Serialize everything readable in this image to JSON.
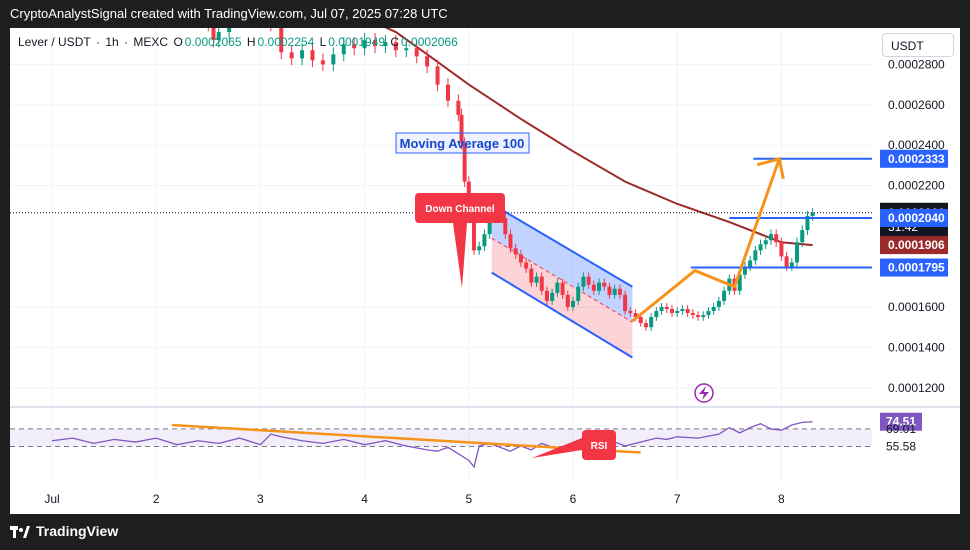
{
  "header": {
    "title": "CryptoAnalystSignal created with TradingView.com, Jul 07, 2025 07:28 UTC"
  },
  "symbol": {
    "pair": "Lever / USDT",
    "interval": "1h",
    "exchange": "MEXC",
    "separator": "·",
    "o_label": "O",
    "o_value": "0.0002065",
    "h_label": "H",
    "h_value": "0.0002254",
    "l_label": "L",
    "l_value": "0.0001949",
    "c_label": "C",
    "c_value": "0.0002066"
  },
  "currency_button": "USDT",
  "footer": {
    "logo_text": "TradingView"
  },
  "colors": {
    "up": "#089981",
    "down": "#f23645",
    "ma": "#9c2a2a",
    "channel": "#2962ff",
    "arrow": "#f7931a",
    "rsi": "#7e57c2",
    "label_red": "#f23645"
  },
  "chart_data": {
    "type": "candlestick",
    "title": "",
    "x_ticks": [
      "Jul",
      "2",
      "3",
      "4",
      "5",
      "6",
      "7",
      "8"
    ],
    "y_ticks": [
      "0.0002800",
      "0.0002600",
      "0.0002400",
      "0.0002200",
      "0.0001600",
      "0.0001400",
      "0.0001200"
    ],
    "ylim": [
      0.000111,
      0.000298
    ],
    "price_labels": [
      {
        "text": "0.0002333",
        "value": 0.0002333,
        "style": "blue"
      },
      {
        "text": "0.0002066",
        "value": 0.0002066,
        "style": "black"
      },
      {
        "text": "31:42",
        "value": 0.0002066,
        "style": "black-sub"
      },
      {
        "text": "0.0002040",
        "value": 0.000204,
        "style": "blue"
      },
      {
        "text": "0.0001906",
        "value": 0.0001906,
        "style": "red"
      },
      {
        "text": "0.0001795",
        "value": 0.0001795,
        "style": "blue"
      }
    ],
    "horizontal_levels": [
      {
        "value": 0.0002333,
        "x_start": 6.73
      },
      {
        "value": 0.000204,
        "x_start": 6.5
      },
      {
        "value": 0.0001795,
        "x_start": 6.13
      }
    ],
    "current_price": 0.0002066,
    "price_series": [
      [
        0.4,
        0.00032
      ],
      [
        0.5,
        0.000318
      ],
      [
        0.6,
        0.000322
      ],
      [
        0.7,
        0.000316
      ],
      [
        0.8,
        0.00032
      ],
      [
        0.9,
        0.000312
      ],
      [
        1.0,
        0.000318
      ],
      [
        1.1,
        0.000311
      ],
      [
        1.2,
        0.000309
      ],
      [
        1.3,
        0.000314
      ],
      [
        1.4,
        0.000306
      ],
      [
        1.5,
        0.0003
      ],
      [
        1.55,
        0.000292
      ],
      [
        1.6,
        0.000296
      ],
      [
        1.7,
        0.000304
      ],
      [
        1.8,
        0.00031
      ],
      [
        1.9,
        0.000303
      ],
      [
        2.0,
        0.000307
      ],
      [
        2.1,
        0.0003
      ],
      [
        2.2,
        0.000286
      ],
      [
        2.3,
        0.000283
      ],
      [
        2.4,
        0.000287
      ],
      [
        2.5,
        0.000282
      ],
      [
        2.6,
        0.00028
      ],
      [
        2.7,
        0.000285
      ],
      [
        2.8,
        0.00029
      ],
      [
        2.9,
        0.000288
      ],
      [
        3.0,
        0.000292
      ],
      [
        3.1,
        0.000289
      ],
      [
        3.2,
        0.000291
      ],
      [
        3.3,
        0.000287
      ],
      [
        3.4,
        0.000288
      ],
      [
        3.5,
        0.000284
      ],
      [
        3.6,
        0.000279
      ],
      [
        3.7,
        0.00027
      ],
      [
        3.8,
        0.000262
      ],
      [
        3.9,
        0.000255
      ],
      [
        3.93,
        0.000241
      ],
      [
        3.96,
        0.000222
      ],
      [
        4.0,
        0.000208
      ],
      [
        4.05,
        0.000188
      ],
      [
        4.1,
        0.00019
      ],
      [
        4.15,
        0.000196
      ],
      [
        4.2,
        0.000207
      ],
      [
        4.25,
        0.000209
      ],
      [
        4.3,
        0.000204
      ],
      [
        4.35,
        0.000196
      ],
      [
        4.4,
        0.000189
      ],
      [
        4.45,
        0.000186
      ],
      [
        4.5,
        0.000182
      ],
      [
        4.55,
        0.000179
      ],
      [
        4.6,
        0.000172
      ],
      [
        4.65,
        0.000175
      ],
      [
        4.7,
        0.000168
      ],
      [
        4.75,
        0.000163
      ],
      [
        4.8,
        0.000167
      ],
      [
        4.85,
        0.000172
      ],
      [
        4.9,
        0.000166
      ],
      [
        4.95,
        0.00016
      ],
      [
        5.0,
        0.000163
      ],
      [
        5.05,
        0.00017
      ],
      [
        5.1,
        0.000175
      ],
      [
        5.15,
        0.000171
      ],
      [
        5.2,
        0.000168
      ],
      [
        5.25,
        0.000172
      ],
      [
        5.3,
        0.00017
      ],
      [
        5.35,
        0.000166
      ],
      [
        5.4,
        0.000169
      ],
      [
        5.45,
        0.000166
      ],
      [
        5.5,
        0.000158
      ],
      [
        5.55,
        0.000157
      ],
      [
        5.6,
        0.000155
      ],
      [
        5.65,
        0.000152
      ],
      [
        5.7,
        0.00015
      ],
      [
        5.75,
        0.000155
      ],
      [
        5.8,
        0.000158
      ],
      [
        5.85,
        0.00016
      ],
      [
        5.9,
        0.000159
      ],
      [
        5.95,
        0.000157
      ],
      [
        6.0,
        0.000158
      ],
      [
        6.05,
        0.000159
      ],
      [
        6.1,
        0.000157
      ],
      [
        6.15,
        0.000156
      ],
      [
        6.2,
        0.000155
      ],
      [
        6.25,
        0.000156
      ],
      [
        6.3,
        0.000158
      ],
      [
        6.35,
        0.00016
      ],
      [
        6.4,
        0.000163
      ],
      [
        6.45,
        0.000168
      ],
      [
        6.5,
        0.000174
      ],
      [
        6.55,
        0.000168
      ],
      [
        6.6,
        0.000176
      ],
      [
        6.65,
        0.00018
      ],
      [
        6.7,
        0.000183
      ],
      [
        6.75,
        0.000188
      ],
      [
        6.8,
        0.000191
      ],
      [
        6.85,
        0.000193
      ],
      [
        6.9,
        0.000196
      ],
      [
        6.95,
        0.000192
      ],
      [
        7.0,
        0.000185
      ],
      [
        7.05,
        0.00018
      ],
      [
        7.1,
        0.000182
      ],
      [
        7.15,
        0.000192
      ],
      [
        7.2,
        0.000198
      ],
      [
        7.25,
        0.000205
      ],
      [
        7.3,
        0.0002066
      ]
    ],
    "moving_average": {
      "label": "Moving Average 100",
      "points": [
        [
          1.2,
          0.000332
        ],
        [
          1.5,
          0.000328
        ],
        [
          2.0,
          0.000321
        ],
        [
          2.5,
          0.000313
        ],
        [
          3.0,
          0.000303
        ],
        [
          3.3,
          0.000296
        ],
        [
          3.6,
          0.000285
        ],
        [
          4.0,
          0.00027
        ],
        [
          4.5,
          0.000253
        ],
        [
          5.0,
          0.000237
        ],
        [
          5.5,
          0.000222
        ],
        [
          6.0,
          0.000211
        ],
        [
          6.5,
          0.000202
        ],
        [
          7.0,
          0.000192
        ],
        [
          7.3,
          0.0001906
        ]
      ]
    },
    "channel": {
      "label": "Down Channel",
      "upper": [
        [
          4.22,
          0.000211
        ],
        [
          5.57,
          0.00017
        ]
      ],
      "lower": [
        [
          4.22,
          0.000177
        ],
        [
          5.57,
          0.000135
        ]
      ]
    },
    "projection_arrow": [
      [
        5.57,
        0.000153
      ],
      [
        6.17,
        0.000178
      ],
      [
        6.55,
        0.00017
      ],
      [
        6.98,
        0.0002333
      ]
    ],
    "rsi": {
      "label": "RSI",
      "current": "74.51",
      "levels": [
        "69.01",
        "55.58"
      ],
      "ylim": [
        30,
        85
      ],
      "series": [
        [
          0.0,
          60
        ],
        [
          0.2,
          62
        ],
        [
          0.4,
          58
        ],
        [
          0.6,
          61
        ],
        [
          0.8,
          59
        ],
        [
          1.0,
          62
        ],
        [
          1.2,
          57
        ],
        [
          1.4,
          60
        ],
        [
          1.6,
          58
        ],
        [
          1.8,
          62
        ],
        [
          2.0,
          57
        ],
        [
          2.1,
          65
        ],
        [
          2.2,
          63
        ],
        [
          2.4,
          60
        ],
        [
          2.6,
          58
        ],
        [
          2.8,
          61
        ],
        [
          3.0,
          57
        ],
        [
          3.2,
          60
        ],
        [
          3.4,
          56
        ],
        [
          3.6,
          53
        ],
        [
          3.7,
          52
        ],
        [
          3.8,
          55
        ],
        [
          3.9,
          50
        ],
        [
          4.0,
          45
        ],
        [
          4.05,
          40
        ],
        [
          4.1,
          56
        ],
        [
          4.2,
          58
        ],
        [
          4.3,
          55
        ],
        [
          4.4,
          52
        ],
        [
          4.5,
          56
        ],
        [
          4.6,
          53
        ],
        [
          4.7,
          58
        ],
        [
          4.8,
          55
        ],
        [
          4.9,
          52
        ],
        [
          5.0,
          58
        ],
        [
          5.1,
          61
        ],
        [
          5.2,
          58
        ],
        [
          5.3,
          60
        ],
        [
          5.4,
          59
        ],
        [
          5.5,
          56
        ],
        [
          5.6,
          58
        ],
        [
          5.7,
          60
        ],
        [
          5.8,
          62
        ],
        [
          5.9,
          61
        ],
        [
          6.0,
          63
        ],
        [
          6.2,
          62
        ],
        [
          6.4,
          65
        ],
        [
          6.5,
          70
        ],
        [
          6.6,
          66
        ],
        [
          6.7,
          70
        ],
        [
          6.8,
          73
        ],
        [
          6.9,
          69
        ],
        [
          7.0,
          68
        ],
        [
          7.1,
          72
        ],
        [
          7.2,
          74
        ],
        [
          7.3,
          74.51
        ]
      ],
      "trendline": [
        [
          1.15,
          72
        ],
        [
          5.65,
          51
        ]
      ]
    },
    "grid": true
  }
}
